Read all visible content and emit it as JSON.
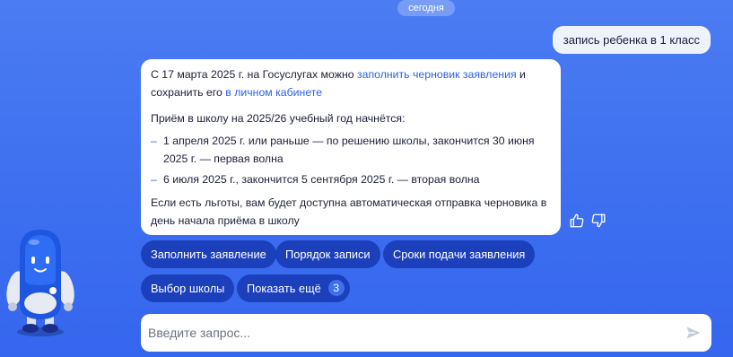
{
  "timeline": {
    "date_label": "сегодня"
  },
  "user_message": {
    "text": "запись ребенка в 1 класс"
  },
  "bot_message": {
    "intro_part1": "С 17 марта 2025 г. на Госуслугах можно ",
    "intro_link1": "заполнить черновик заявления",
    "intro_part2": " и сохранить его ",
    "intro_link2": "в личном кабинете",
    "heading": "Приём в школу на 2025/26 учебный год начнётся:",
    "bullets": [
      "1 апреля 2025 г. или раньше — по решению школы, закончится 30 июня 2025 г. — первая волна",
      "6 июля 2025 г., закончится 5 сентября 2025 г. — вторая волна"
    ],
    "bullet_marker": "–",
    "footer": "Если есть льготы, вам будет доступна автоматическая отправка черновика в день начала приёма в школу"
  },
  "feedback": {
    "like_icon": "thumbs-up-icon",
    "dislike_icon": "thumbs-down-icon"
  },
  "quick_replies": [
    {
      "label": "Заполнить заявление"
    },
    {
      "label": "Порядок записи"
    },
    {
      "label": "Сроки подачи заявления"
    },
    {
      "label": "Выбор школы"
    },
    {
      "label": "Показать ещё",
      "count": "3"
    }
  ],
  "composer": {
    "placeholder": "Введите запрос...",
    "value": "",
    "send_icon": "send-icon"
  },
  "assistant": {
    "avatar_icon": "robot-mascot-icon"
  },
  "colors": {
    "background": "#4174f1",
    "chip": "#1c3fbb",
    "link": "#2d62e8",
    "bubble_user": "#eef2fb",
    "bubble_bot": "#ffffff"
  }
}
